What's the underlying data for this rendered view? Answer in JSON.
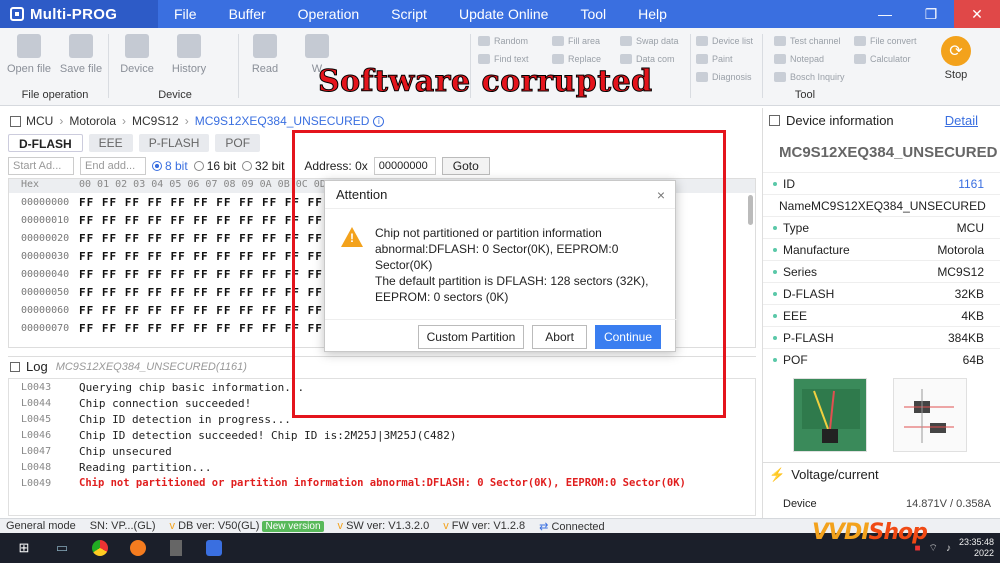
{
  "app": {
    "title": "Multi-PROG"
  },
  "menu": [
    "File",
    "Buffer",
    "Operation",
    "Script",
    "Update Online",
    "Tool",
    "Help"
  ],
  "window_controls": {
    "minimize": "—",
    "maximize": "❐",
    "close": "✕"
  },
  "toolbar": {
    "file_group": {
      "label": "File operation",
      "open": "Open file",
      "save": "Save file"
    },
    "device_group": {
      "label": "Device",
      "device": "Device",
      "history": "History"
    },
    "read": "Read",
    "write": "W",
    "small": {
      "random": "Random",
      "fill_area": "Fill area",
      "swap_data": "Swap data",
      "device_list": "Device list",
      "find_text": "Find text",
      "data_com": "Data com",
      "paint": "Paint",
      "replace": "Replace",
      "diagnosis": "Diagnosis",
      "test_channel": "Test channel",
      "file_convert": "File convert",
      "notepad": "Notepad",
      "calculator": "Calculator",
      "bosch_inquiry": "Bosch Inquiry"
    },
    "tool_label": "Tool",
    "stop": "Stop"
  },
  "banner": "Software corrupted",
  "breadcrumb": {
    "mcu": "MCU",
    "brand": "Motorola",
    "family": "MC9S12",
    "chip": "MC9S12XEQ384_UNSECURED"
  },
  "tabs": [
    "D-FLASH",
    "EEE",
    "P-FLASH",
    "POF"
  ],
  "address": {
    "start_placeholder": "Start Ad...",
    "end_placeholder": "End add...",
    "bit8": "8 bit",
    "bit16": "16 bit",
    "bit32": "32 bit",
    "label": "Address: 0x",
    "value": "00000000",
    "goto": "Goto"
  },
  "hex": {
    "header_addr": "Hex",
    "header_cols": "00 01 02 03 04 05 06 07 08 09 0A 0B 0C 0D 0E 0F",
    "rows": [
      {
        "addr": "00000000",
        "bytes": "FF FF FF FF FF FF FF FF FF FF FF FF FF FF FF FF"
      },
      {
        "addr": "00000010",
        "bytes": "FF FF FF FF FF FF FF FF FF FF FF FF FF FF FF FF"
      },
      {
        "addr": "00000020",
        "bytes": "FF FF FF FF FF FF FF FF FF FF FF FF FF FF FF FF"
      },
      {
        "addr": "00000030",
        "bytes": "FF FF FF FF FF FF FF FF FF FF FF FF FF FF FF FF"
      },
      {
        "addr": "00000040",
        "bytes": "FF FF FF FF FF FF FF FF FF FF FF FF FF FF FF FF"
      },
      {
        "addr": "00000050",
        "bytes": "FF FF FF FF FF FF FF FF FF FF FF FF FF FF FF FF"
      },
      {
        "addr": "00000060",
        "bytes": "FF FF FF FF FF FF FF FF FF FF FF FF FF FF FF FF"
      },
      {
        "addr": "00000070",
        "bytes": "FF FF FF FF FF FF FF FF FF FF FF FF FF FF FF FF"
      }
    ]
  },
  "log": {
    "title": "Log",
    "chip": "MC9S12XEQ384_UNSECURED(1161)",
    "lines": [
      {
        "n": "L0043",
        "t": "Querying chip basic information..."
      },
      {
        "n": "L0044",
        "t": "Chip connection succeeded!"
      },
      {
        "n": "L0045",
        "t": "Chip ID detection in progress..."
      },
      {
        "n": "L0046",
        "t": "Chip ID detection succeeded! Chip ID is:2M25J|3M25J(C482)"
      },
      {
        "n": "L0047",
        "t": "Chip unsecured"
      },
      {
        "n": "L0048",
        "t": "Reading partition..."
      },
      {
        "n": "L0049",
        "t": "Chip not partitioned or partition information abnormal:DFLASH: 0 Sector(0K), EEPROM:0 Sector(0K)"
      }
    ]
  },
  "device_info": {
    "title": "Device information",
    "detail": "Detail",
    "chip": "MC9S12XEQ384_UNSECURED",
    "props": [
      {
        "k": "ID",
        "v": "1161"
      },
      {
        "k": "Name",
        "v": "MC9S12XEQ384_UNSECURED"
      },
      {
        "k": "Type",
        "v": "MCU"
      },
      {
        "k": "Manufacture",
        "v": "Motorola"
      },
      {
        "k": "Series",
        "v": "MC9S12"
      },
      {
        "k": "D-FLASH",
        "v": "32KB"
      },
      {
        "k": "EEE",
        "v": "4KB"
      },
      {
        "k": "P-FLASH",
        "v": "384KB"
      },
      {
        "k": "POF",
        "v": "64B"
      }
    ],
    "voltage_title": "Voltage/current",
    "device_label": "Device",
    "device_value": "14.871V / 0.358A"
  },
  "dialog": {
    "title": "Attention",
    "close": "×",
    "line1": "Chip not partitioned or partition information abnormal:DFLASH: 0 Sector(0K), EEPROM:0 Sector(0K)",
    "line2": "The default partition is DFLASH: 128 sectors (32K), EEPROM: 0 sectors (0K)",
    "custom": "Custom Partition",
    "abort": "Abort",
    "continue": "Continue"
  },
  "status": {
    "mode": "General mode",
    "sn": "SN: VP...(GL)",
    "db": "DB ver: V50(GL)",
    "new_version": "New version",
    "sw": "SW ver: V1.3.2.0",
    "fw": "FW ver: V1.2.8",
    "conn": "Connected"
  },
  "taskbar": {
    "time": "23:35:48",
    "date": "2022"
  },
  "watermark": {
    "a": "VVDI",
    "b": "Shop"
  },
  "colors": {
    "accent": "#3a6fe0",
    "error": "#e01e1e",
    "warning": "#f3a21c"
  }
}
